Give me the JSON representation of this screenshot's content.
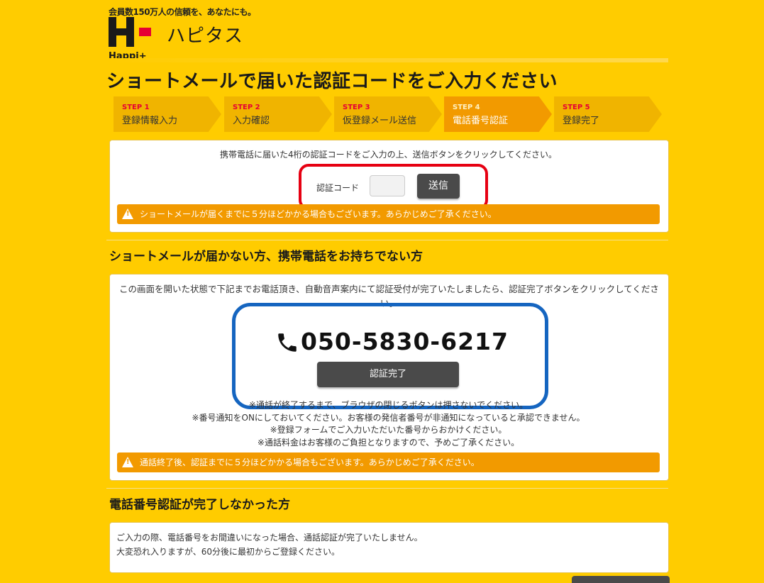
{
  "header": {
    "tagline": "会員数150万人の信頼を、あなたにも。",
    "brand_text": "Happi+",
    "brand_name": "ハピタス"
  },
  "page_title": "ショートメールで届いた認証コードをご入力ください",
  "steps": [
    {
      "num": "STEP 1",
      "label": "登録情報入力",
      "active": false
    },
    {
      "num": "STEP 2",
      "label": "入力確認",
      "active": false
    },
    {
      "num": "STEP 3",
      "label": "仮登録メール送信",
      "active": false
    },
    {
      "num": "STEP 4",
      "label": "電話番号認証",
      "active": true
    },
    {
      "num": "STEP 5",
      "label": "登録完了",
      "active": false
    }
  ],
  "sms_section": {
    "instruction": "携帯電話に届いた4桁の認証コードをご入力の上、送信ボタンをクリックしてください。",
    "code_label": "認証コード",
    "code_value": "",
    "send_label": "送信",
    "warning": "ショートメールが届くまでに５分ほどかかる場合もございます。あらかじめご了承ください。"
  },
  "call_section": {
    "title": "ショートメールが届かない方、携帯電話をお持ちでない方",
    "instruction": "この画面を開いた状態で下記までお電話頂き、自動音声案内にて認証受付が完了いたしましたら、認証完了ボタンをクリックしてください。",
    "phone": "050-5830-6217",
    "confirm_label": "認証完了",
    "notes": [
      "※通話が終了するまで、ブラウザの閉じるボタンは押さないでください。",
      "※番号通知をONにしておいてください。お客様の発信者番号が非通知になっていると承認できません。",
      "※登録フォームでご入力いただいた番号からおかけください。",
      "※通話料金はお客様のご負担となりますので、予めご了承ください。"
    ],
    "warning": "通話終了後、認証までに５分ほどかかる場合もございます。あらかじめご了承ください。"
  },
  "incomplete_section": {
    "title": "電話番号認証が完了しなかった方",
    "lines": [
      "ご入力の際、電話番号をお間違いになった場合、通話認証が完了いたしません。",
      "大変恐れ入りますが、60分後に最初からご登録ください。"
    ]
  },
  "colors": {
    "background": "#ffcc00",
    "step": "#f0b400",
    "step_active": "#f29a00",
    "warning": "#f29a00",
    "button": "#4a4a4a",
    "highlight_red": "#e60012",
    "highlight_blue": "#1565c0"
  },
  "icons": {
    "warning": "warning-icon",
    "phone": "phone-icon"
  }
}
